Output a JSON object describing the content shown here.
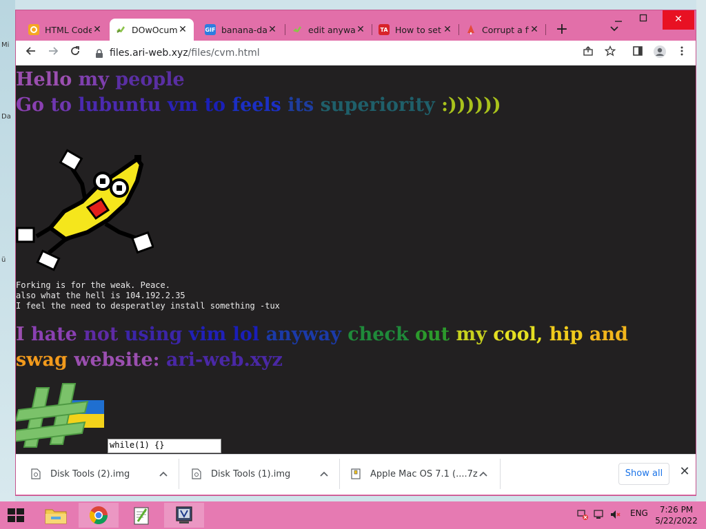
{
  "desktop": {
    "left_labels": [
      "Mi",
      "Da",
      "ü"
    ]
  },
  "browser": {
    "tabs": [
      {
        "title": "HTML Code",
        "favicon": "code-favicon",
        "color": "#f5a623",
        "active": false
      },
      {
        "title": "DOwOcume",
        "favicon": "banana-favicon",
        "color": "#7aa34a",
        "active": true
      },
      {
        "title": "banana-da",
        "favicon": "gif-favicon",
        "color": "#2d7de0",
        "active": false
      },
      {
        "title": "edit anyway",
        "favicon": "banana-favicon",
        "color": "#7aa34a",
        "active": false
      },
      {
        "title": "How to set",
        "favicon": "ta-favicon",
        "color": "#d8232a",
        "active": false
      },
      {
        "title": "Corrupt a fi",
        "favicon": "tree-favicon",
        "color": "#e34b3c",
        "active": false
      }
    ],
    "gif_label": "GIF",
    "ta_label": "TA",
    "new_tab_symbol": "+",
    "tab_close_symbol": "✕",
    "url_domain": "files.ari-web.xyz",
    "url_path": "/files/cvm.html",
    "window_controls": {
      "minimize": "—",
      "maximize": "☐",
      "close": "✕"
    }
  },
  "page": {
    "line1": [
      {
        "text": "Hello ",
        "color": "#9b4fb0"
      },
      {
        "text": "my ",
        "color": "#7e3fae"
      },
      {
        "text": "people",
        "color": "#5a2fa3"
      }
    ],
    "line2": [
      {
        "text": "Go ",
        "color": "#8a40b2"
      },
      {
        "text": "to ",
        "color": "#6f37b0"
      },
      {
        "text": "lubuntu ",
        "color": "#4b2ab0"
      },
      {
        "text": "vm ",
        "color": "#2a22b5"
      },
      {
        "text": "to ",
        "color": "#1a1fb8"
      },
      {
        "text": "feels ",
        "color": "#1b2fc4"
      },
      {
        "text": "its ",
        "color": "#1e3da0"
      },
      {
        "text": "superiority ",
        "color": "#1f5f6a"
      },
      {
        "text": ":))))))",
        "color": "#a9c21c"
      }
    ],
    "mono_lines": [
      "Forking is for the weak. Peace.",
      "also what the hell is 104.192.2.35",
      "I feel the need to desperatley install something -tux"
    ],
    "line3": [
      {
        "text": "I ",
        "color": "#9b4fb0"
      },
      {
        "text": "hate ",
        "color": "#8a40b2"
      },
      {
        "text": "not ",
        "color": "#5e2ba6"
      },
      {
        "text": "using ",
        "color": "#3b25a8"
      },
      {
        "text": "vim ",
        "color": "#2020b8"
      },
      {
        "text": "lol ",
        "color": "#1a1eb9"
      },
      {
        "text": "anyway ",
        "color": "#1b3aa8"
      },
      {
        "text": "check ",
        "color": "#1f8a3a"
      },
      {
        "text": "out ",
        "color": "#2c9a2c"
      },
      {
        "text": "my ",
        "color": "#c8d21e"
      },
      {
        "text": "cool, ",
        "color": "#e4df22"
      },
      {
        "text": "hip ",
        "color": "#f0cb1c"
      },
      {
        "text": "and ",
        "color": "#f2b51c"
      },
      {
        "text": "swag ",
        "color": "#f29a1c"
      },
      {
        "text": "website: ",
        "color": "#9b4fb0"
      },
      {
        "text": "ari-web.xyz",
        "color": "#4a28a6"
      }
    ],
    "code_input_value": "while(1) {}"
  },
  "downloads": {
    "items": [
      {
        "name": "Disk Tools (2).img"
      },
      {
        "name": "Disk Tools (1).img"
      },
      {
        "name": "Apple Mac OS 7.1 (....7z"
      }
    ],
    "show_all": "Show all",
    "close_symbol": "✕"
  },
  "taskbar": {
    "language": "ENG",
    "time": "7:26 PM",
    "date": "5/22/2022"
  }
}
